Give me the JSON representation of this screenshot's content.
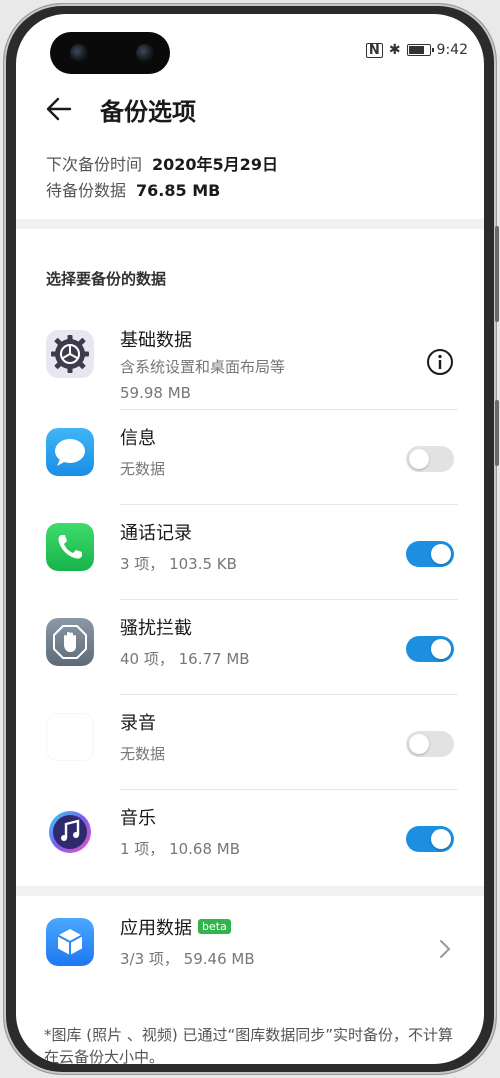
{
  "status_bar": {
    "nfc": "N",
    "bluetooth": "✱",
    "time": "9:42"
  },
  "header": {
    "title": "备份选项"
  },
  "summary": {
    "next_backup_label": "下次备份时间",
    "next_backup_value": "2020年5月29日",
    "pending_label": "待备份数据",
    "pending_value": "76.85 MB"
  },
  "section": {
    "label": "选择要备份的数据"
  },
  "items": [
    {
      "name": "基础数据",
      "desc": "含系统设置和桌面布局等",
      "size": "59.98 MB",
      "icon": "settings-gear-icon",
      "control": "info"
    },
    {
      "name": "信息",
      "desc": "无数据",
      "icon": "message-bubble-icon",
      "control": "toggle",
      "enabled": false
    },
    {
      "name": "通话记录",
      "desc": "3 项， 103.5 KB",
      "icon": "phone-icon",
      "control": "toggle",
      "enabled": true
    },
    {
      "name": "骚扰拦截",
      "desc": "40 项， 16.77 MB",
      "icon": "hand-block-icon",
      "control": "toggle",
      "enabled": true
    },
    {
      "name": "录音",
      "desc": "无数据",
      "icon": "sound-wave-icon",
      "control": "toggle",
      "enabled": false
    },
    {
      "name": "音乐",
      "desc": "1 项， 10.68 MB",
      "icon": "music-note-icon",
      "control": "toggle",
      "enabled": true
    }
  ],
  "app_data": {
    "name": "应用数据",
    "badge": "beta",
    "desc": "3/3 项， 59.46 MB",
    "icon": "cube-box-icon"
  },
  "footnote": "*图库 (照片 、视频) 已通过“图库数据同步”实时备份，不计算在云备份大小中。",
  "colors": {
    "toggle_on": "#1c8fe0",
    "toggle_off": "#e2e2e2",
    "beta_badge": "#2fb54a"
  }
}
